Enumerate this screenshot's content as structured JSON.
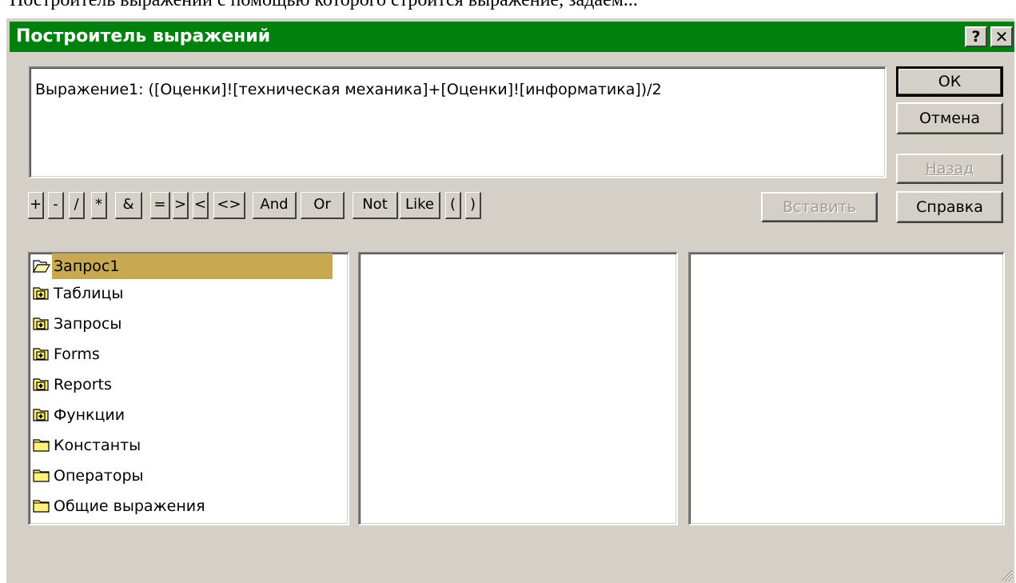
{
  "caption_above": "Построитель выражений с помощью которого строится выражение, задаем...",
  "dialog": {
    "title": "Построитель выражений",
    "help_button": "?",
    "close_button": "✕"
  },
  "expression": {
    "value": "Выражение1: ([Оценки]![техническая механика]+[Оценки]![информатика])/2"
  },
  "buttons": {
    "ok": "ОК",
    "cancel": "Отмена",
    "back": "Назад",
    "insert": "Вставить",
    "help": "Справка"
  },
  "operators": [
    "+",
    "-",
    "/",
    "*",
    "&",
    "=",
    ">",
    "<",
    "<>",
    "And",
    "Or",
    "Not",
    "Like",
    "(",
    ")"
  ],
  "tree": {
    "items": [
      {
        "label": "Запрос1",
        "icon": "open-folder-icon",
        "selected": true
      },
      {
        "label": "Таблицы",
        "icon": "plus-folder-icon"
      },
      {
        "label": "Запросы",
        "icon": "plus-folder-icon"
      },
      {
        "label": "Forms",
        "icon": "plus-folder-icon"
      },
      {
        "label": "Reports",
        "icon": "plus-folder-icon"
      },
      {
        "label": "Функции",
        "icon": "plus-folder-icon"
      },
      {
        "label": "Константы",
        "icon": "folder-icon"
      },
      {
        "label": "Операторы",
        "icon": "folder-icon"
      },
      {
        "label": "Общие выражения",
        "icon": "folder-icon"
      }
    ]
  },
  "colors": {
    "titlebar": "#00800f",
    "dialog_face": "#d4d0c8",
    "selection": "#c8a850"
  }
}
